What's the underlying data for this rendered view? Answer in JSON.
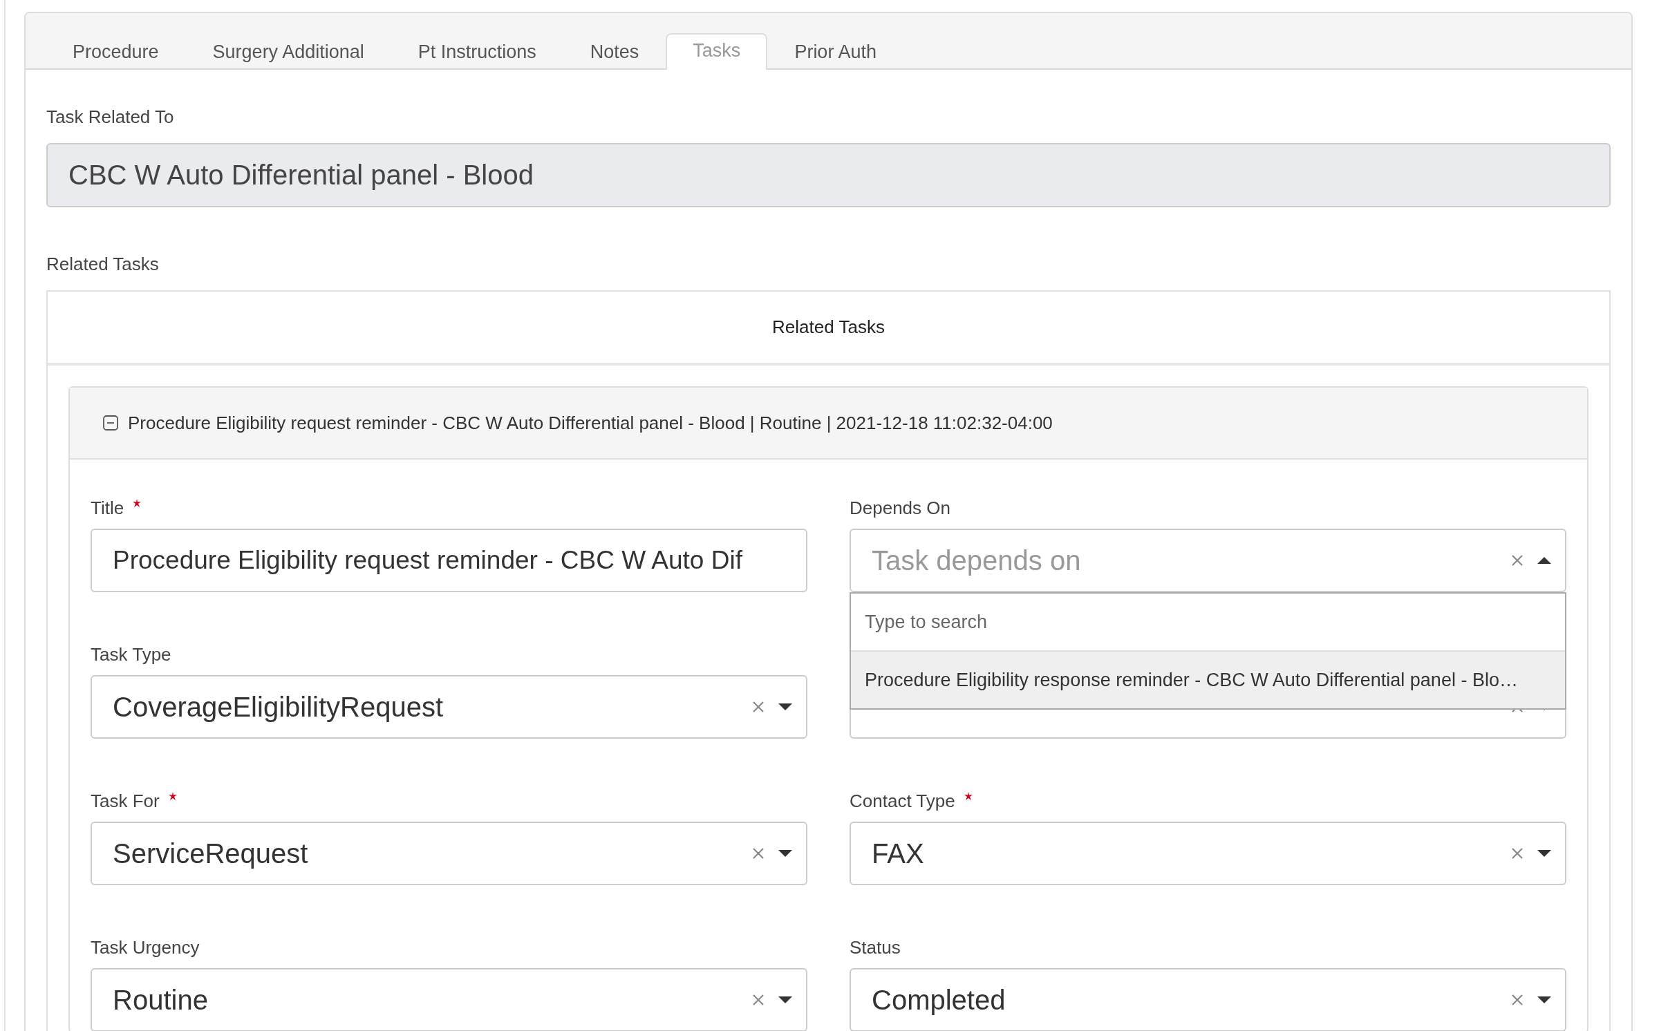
{
  "tabs": [
    {
      "label": "Procedure",
      "selected": false
    },
    {
      "label": "Surgery Additional",
      "selected": false
    },
    {
      "label": "Pt Instructions",
      "selected": false
    },
    {
      "label": "Notes",
      "selected": false
    },
    {
      "label": "Tasks",
      "selected": true
    },
    {
      "label": "Prior Auth",
      "selected": false
    }
  ],
  "task_related_to": {
    "label": "Task Related To",
    "value": "CBC W Auto Differential panel - Blood"
  },
  "related_tasks": {
    "label": "Related Tasks",
    "heading": "Related Tasks",
    "tasks": [
      {
        "expanded": true,
        "summary": "Procedure Eligibility request reminder - CBC W Auto Differential panel - Blood | Routine | 2021-12-18 11:02:32-04:00",
        "left_fields": [
          {
            "kind": "text",
            "label": "Title",
            "required": true,
            "value": "Procedure Eligibility request reminder - CBC W Auto Dif"
          },
          {
            "kind": "select",
            "label": "Task Type",
            "required": false,
            "value": "CoverageEligibilityRequest",
            "clearable": true,
            "open": false
          },
          {
            "kind": "select",
            "label": "Task For",
            "required": true,
            "value": "ServiceRequest",
            "clearable": true,
            "open": false
          },
          {
            "kind": "select",
            "label": "Task Urgency",
            "required": false,
            "value": "Routine",
            "clearable": true,
            "open": false
          }
        ],
        "right_fields": [
          {
            "kind": "select",
            "label": "Depends On",
            "required": false,
            "placeholder": "Task depends on",
            "clearable": true,
            "open": true,
            "dropdown": {
              "search_placeholder": "Type to search",
              "options": [
                {
                  "label": "Procedure Eligibility response reminder - CBC W Auto Differential panel - Blo…",
                  "highlighted": true
                }
              ]
            }
          },
          {
            "kind": "select",
            "clearable": true,
            "open": false
          },
          {
            "kind": "select",
            "label": "Contact Type",
            "required": true,
            "value": "FAX",
            "clearable": true,
            "open": false
          },
          {
            "kind": "select",
            "label": "Status",
            "required": false,
            "value": "Completed",
            "clearable": true,
            "open": false
          }
        ]
      }
    ]
  }
}
